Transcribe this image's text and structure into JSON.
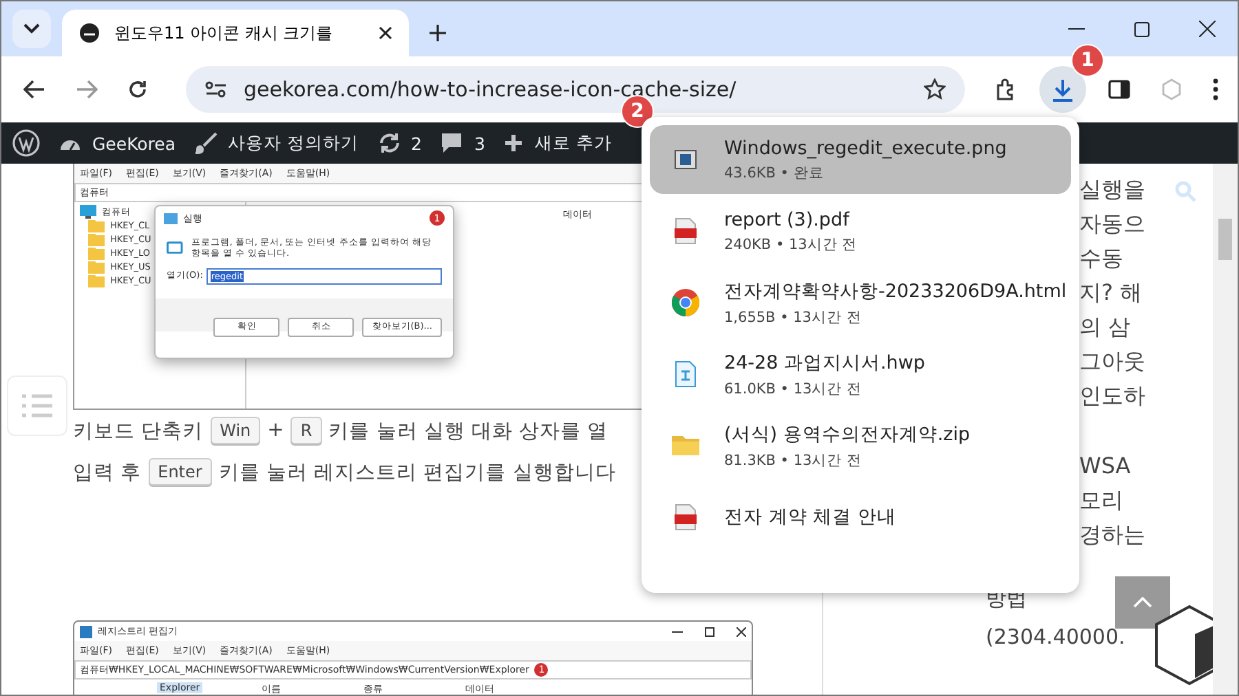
{
  "browser": {
    "tab_title": "윈도우11 아이콘 캐시 크기를",
    "url": "geekorea.com/how-to-increase-icon-cache-size/"
  },
  "callouts": [
    "1",
    "2"
  ],
  "admin_bar": {
    "site": "GeeKorea",
    "customize": "사용자 정의하기",
    "updates": "2",
    "comments": "3",
    "new": "새로 추가"
  },
  "figure_1": {
    "menu": [
      "파일(F)",
      "편집(E)",
      "보기(V)",
      "즐겨찾기(A)",
      "도움말(H)"
    ],
    "address": "컴퓨터",
    "tree_root": "컴퓨터",
    "tree_items": [
      "HKEY_CL",
      "HKEY_CU",
      "HKEY_LO",
      "HKEY_US",
      "HKEY_CU"
    ],
    "column": "데이터",
    "dialog": {
      "title": "실행",
      "badge": "1",
      "message": "프로그램, 폴더, 문서, 또는 인터넷 주소를 입력하여 해당 항목을 열 수 있습니다.",
      "open_label": "열기(O):",
      "value": "regedit",
      "buttons": [
        "확인",
        "취소",
        "찾아보기(B)..."
      ]
    }
  },
  "paragraph": [
    [
      {
        "kind": "text",
        "text": "키보드 단축키"
      },
      {
        "kind": "key",
        "text": "Win"
      },
      {
        "kind": "text",
        "text": "+"
      },
      {
        "kind": "key",
        "text": "R"
      },
      {
        "kind": "text",
        "text": "키를 눌러 실행 대화 상자를 열"
      }
    ],
    [
      {
        "kind": "text",
        "text": "입력 후"
      },
      {
        "kind": "key",
        "text": "Enter"
      },
      {
        "kind": "text",
        "text": "키를 눌러 레지스트리 편집기를 실행합니다"
      }
    ]
  ],
  "figure_2": {
    "title": "레지스트리 편집기",
    "menu": [
      "파일(F)",
      "편집(E)",
      "보기(V)",
      "즐겨찾기(A)",
      "도움말(H)"
    ],
    "badge": "1",
    "address": "컴퓨터₩HKEY_LOCAL_MACHINE₩SOFTWARE₩Microsoft₩Windows₩CurrentVersion₩Explorer",
    "tree_item": "Explorer",
    "columns": [
      "이름",
      "종류",
      "데이터"
    ]
  },
  "downloads": [
    {
      "kind": "image",
      "name": "Windows_regedit_execute.png",
      "meta": "43.6KB • 완료",
      "selected": true
    },
    {
      "kind": "pdf",
      "name": "report (3).pdf",
      "meta": "240KB • 13시간 전",
      "selected": false
    },
    {
      "kind": "html",
      "name": "전자계약확약사항-20233206D9A.html",
      "meta": "1,655B • 13시간 전",
      "selected": false
    },
    {
      "kind": "hwp",
      "name": "24-28 과업지시서.hwp",
      "meta": "61.0KB • 13시간 전",
      "selected": false
    },
    {
      "kind": "zip",
      "name": "(서식) 용역수의전자계약.zip",
      "meta": "81.3KB • 13시간 전",
      "selected": false
    },
    {
      "kind": "pdf",
      "name": "전자 계약 체결 안내",
      "selected": false
    }
  ],
  "sidebar_fragments": [
    [
      "실행을",
      "자동으",
      "수동",
      "지? 해",
      "의 삼",
      "그아웃",
      "인도하"
    ],
    [
      "WSA",
      "모리",
      "경하는"
    ]
  ],
  "sidebar_text": [
    "방법",
    "(2304.40000."
  ]
}
